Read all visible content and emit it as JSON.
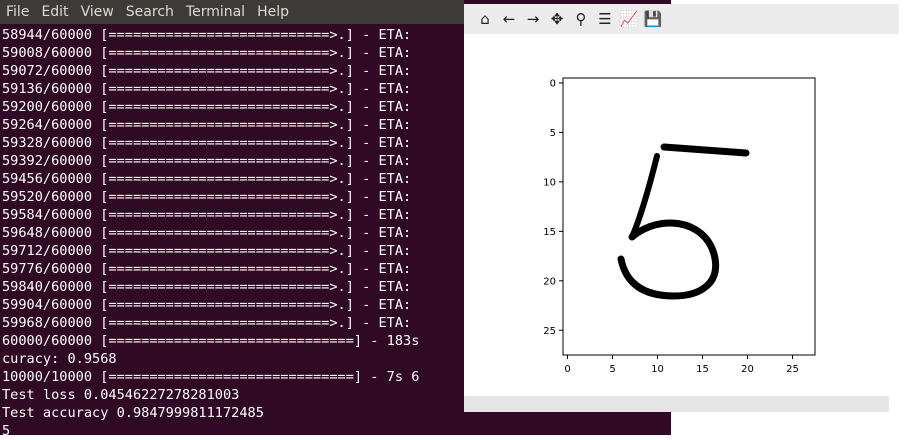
{
  "menu": [
    "File",
    "Edit",
    "View",
    "Search",
    "Terminal",
    "Help"
  ],
  "terminal_lines": [
    "58944/60000 [===========================>.] - ETA:",
    "59008/60000 [===========================>.] - ETA:",
    "59072/60000 [===========================>.] - ETA:",
    "59136/60000 [===========================>.] - ETA:",
    "59200/60000 [===========================>.] - ETA:",
    "59264/60000 [===========================>.] - ETA:",
    "59328/60000 [===========================>.] - ETA:",
    "59392/60000 [===========================>.] - ETA:",
    "59456/60000 [===========================>.] - ETA:",
    "59520/60000 [===========================>.] - ETA:",
    "59584/60000 [===========================>.] - ETA:",
    "59648/60000 [===========================>.] - ETA:",
    "59712/60000 [===========================>.] - ETA:",
    "59776/60000 [===========================>.] - ETA:",
    "59840/60000 [===========================>.] - ETA:",
    "59904/60000 [===========================>.] - ETA:",
    "59968/60000 [===========================>.] - ETA:",
    "60000/60000 [==============================] - 183s",
    "curacy: 0.9568",
    "10000/10000 [==============================] - 7s 6",
    "Test loss 0.04546227278281003",
    "Test accuracy 0.9847999811172485",
    "5"
  ],
  "toolbar_icons": [
    "home-icon",
    "back-icon",
    "forward-icon",
    "pan-icon",
    "zoom-icon",
    "subplots-icon",
    "edit-axes-icon",
    "save-icon"
  ],
  "toolbar_glyphs": [
    "⌂",
    "←",
    "→",
    "✥",
    "⚲",
    "☰",
    "📈",
    "💾"
  ],
  "plot": {
    "x_ticks": [
      "0",
      "5",
      "10",
      "15",
      "20",
      "25"
    ],
    "y_ticks": [
      "0",
      "5",
      "10",
      "15",
      "20",
      "25"
    ]
  },
  "chart_data": {
    "type": "image",
    "title": "",
    "xlim": [
      -0.5,
      27.5
    ],
    "ylim": [
      27.5,
      -0.5
    ],
    "xticks": [
      0,
      5,
      10,
      15,
      20,
      25
    ],
    "yticks": [
      0,
      5,
      10,
      15,
      20,
      25
    ],
    "content": "handwritten digit 5"
  }
}
